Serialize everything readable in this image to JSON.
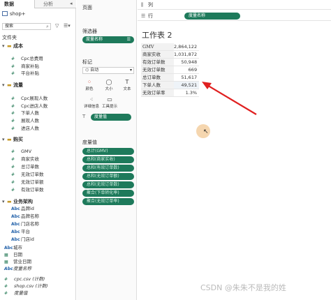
{
  "left_pane": {
    "tab_data": "数据",
    "tab_analytics": "分析",
    "source_name": "shop+",
    "search_placeholder": "搜索",
    "folder_header": "文件夹",
    "groups": {
      "cost": "成本",
      "traffic": "流量",
      "purchase": "购买",
      "business": "业务架构"
    },
    "cost_items": [
      "Cpc总费用",
      "商家补贴",
      "平台补贴"
    ],
    "traffic_items": [
      "Cpc展现人数",
      "Cpc进店人数",
      "下单人数",
      "展现人数",
      "进店人数"
    ],
    "purchase_items": [
      "GMV",
      "商家实收",
      "总订单数",
      "无效订单数",
      "无效订单额",
      "有效订单数"
    ],
    "business_items": [
      "品牌id",
      "品牌名称",
      "门店名称",
      "平台",
      "门店id"
    ],
    "top_items": [
      "城市",
      "日期",
      "营业日期",
      "度量名称"
    ],
    "file_items": [
      "cpc.csv (计数)",
      "shop.csv (计数)",
      "度量值"
    ],
    "marker_dim": "Abc",
    "marker_num": "#"
  },
  "col2": {
    "pages_title": "页面",
    "filters_title": "筛选器",
    "filter_pill": "度量名称",
    "marks_title": "标记",
    "marks_type": "自动",
    "mark_buttons": [
      "颜色",
      "大小",
      "文本",
      "详细信息",
      "工具提示"
    ],
    "measure_pill": "度量值",
    "measure_values_title": "度量值",
    "measure_pills": [
      "总计(GMV)",
      "总和(商家实收)",
      "总和(有效订单数)",
      "总和(无效订单额)",
      "总和(无效订单数)",
      "聚合(下单转化率)",
      "聚合(无效订单率)"
    ]
  },
  "main": {
    "columns_label": "列",
    "rows_label": "行",
    "rows_pill": "度量名称",
    "sheet_title": "工作表 2",
    "table": [
      {
        "k": "GMV",
        "v": "2,864,122"
      },
      {
        "k": "商家实收",
        "v": "1,031,872"
      },
      {
        "k": "有效订单数",
        "v": "50,948"
      },
      {
        "k": "无效订单数",
        "v": "669"
      },
      {
        "k": "总订单数",
        "v": "51,617"
      },
      {
        "k": "下单人数",
        "v": "49,521"
      },
      {
        "k": "无效订单率",
        "v": "1.3%"
      }
    ]
  },
  "watermark": "CSDN @朱朱不是我的姓",
  "colors": {
    "pill_green": "#1e7a5b",
    "arrow_red": "#e02020"
  }
}
